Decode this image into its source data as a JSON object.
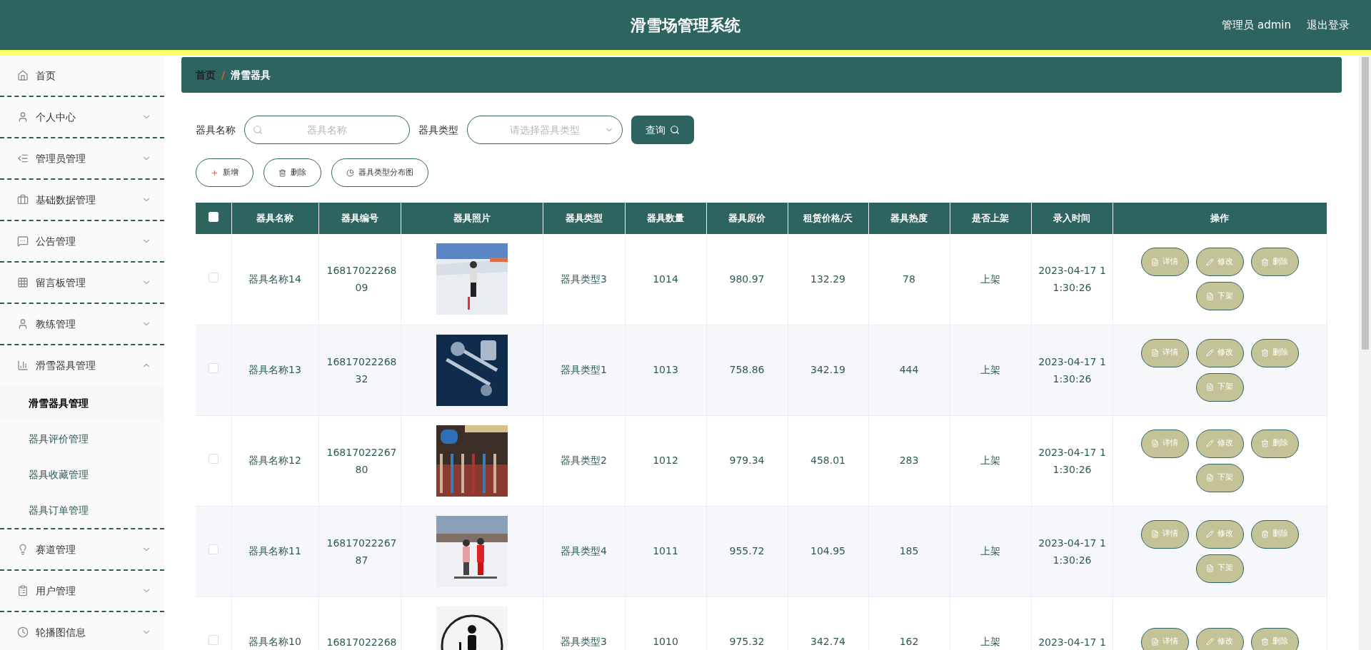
{
  "header": {
    "title": "滑雪场管理系统",
    "user": "管理员 admin",
    "logout": "退出登录"
  },
  "sidebar": {
    "items": [
      {
        "label": "首页"
      },
      {
        "label": "个人中心",
        "expanded": false
      },
      {
        "label": "管理员管理",
        "expanded": false
      },
      {
        "label": "基础数据管理",
        "expanded": false
      },
      {
        "label": "公告管理",
        "expanded": false
      },
      {
        "label": "留言板管理",
        "expanded": false
      },
      {
        "label": "教练管理",
        "expanded": false
      },
      {
        "label": "滑雪器具管理",
        "expanded": true,
        "children": [
          {
            "label": "滑雪器具管理",
            "selected": true
          },
          {
            "label": "器具评价管理",
            "selected": false
          },
          {
            "label": "器具收藏管理",
            "selected": false
          },
          {
            "label": "器具订单管理",
            "selected": false
          }
        ]
      },
      {
        "label": "赛道管理",
        "expanded": false
      },
      {
        "label": "用户管理",
        "expanded": false
      },
      {
        "label": "轮播图信息",
        "expanded": false
      }
    ]
  },
  "breadcrumb": [
    "首页",
    "/",
    "滑雪器具"
  ],
  "search": {
    "fields": [
      {
        "label": "器具名称",
        "kind": "text",
        "placeholder": "器具名称"
      },
      {
        "label": "器具类型",
        "kind": "select",
        "placeholder": "请选择器具类型"
      }
    ],
    "button": "查询"
  },
  "actions": [
    {
      "label": "新增",
      "kind": "add"
    },
    {
      "label": "删除",
      "kind": "delete"
    },
    {
      "label": "器具类型分布图",
      "kind": "chart"
    }
  ],
  "table": {
    "header_checked": false,
    "columns": [
      "器具名称",
      "器具编号",
      "器具照片",
      "器具类型",
      "器具数量",
      "器具原价",
      "租赁价格/天",
      "器具热度",
      "是否上架",
      "录入时间",
      "操作"
    ],
    "rows": [
      {
        "checked": false,
        "name": "器具名称14",
        "code": "1681702226809",
        "photo": {
          "kind": "picture"
        },
        "type": "器具类型3",
        "qty": "1014",
        "price": "980.97",
        "rent": "132.29",
        "heat": "78",
        "shelf": "上架",
        "time": "2023-04-17 11:30:26",
        "ops": [
          {
            "label": "详情",
            "kind": "detail"
          },
          {
            "label": "修改",
            "kind": "edit"
          },
          {
            "label": "删除",
            "kind": "delete"
          },
          {
            "label": "下架",
            "kind": "detail"
          }
        ]
      },
      {
        "checked": false,
        "name": "器具名称13",
        "code": "1681702226832",
        "photo": {
          "kind": "picture"
        },
        "type": "器具类型1",
        "qty": "1013",
        "price": "758.86",
        "rent": "342.19",
        "heat": "444",
        "shelf": "上架",
        "time": "2023-04-17 11:30:26",
        "ops": [
          {
            "label": "详情",
            "kind": "detail"
          },
          {
            "label": "修改",
            "kind": "edit"
          },
          {
            "label": "删除",
            "kind": "delete"
          },
          {
            "label": "下架",
            "kind": "detail"
          }
        ]
      },
      {
        "checked": false,
        "name": "器具名称12",
        "code": "1681702226780",
        "photo": {
          "kind": "picture"
        },
        "type": "器具类型2",
        "qty": "1012",
        "price": "979.34",
        "rent": "458.01",
        "heat": "283",
        "shelf": "上架",
        "time": "2023-04-17 11:30:26",
        "ops": [
          {
            "label": "详情",
            "kind": "detail"
          },
          {
            "label": "修改",
            "kind": "edit"
          },
          {
            "label": "删除",
            "kind": "delete"
          },
          {
            "label": "下架",
            "kind": "detail"
          }
        ]
      },
      {
        "checked": false,
        "name": "器具名称11",
        "code": "1681702226787",
        "photo": {
          "kind": "picture"
        },
        "type": "器具类型4",
        "qty": "1011",
        "price": "955.72",
        "rent": "104.95",
        "heat": "185",
        "shelf": "上架",
        "time": "2023-04-17 11:30:26",
        "ops": [
          {
            "label": "详情",
            "kind": "detail"
          },
          {
            "label": "修改",
            "kind": "edit"
          },
          {
            "label": "删除",
            "kind": "delete"
          },
          {
            "label": "下架",
            "kind": "detail"
          }
        ]
      },
      {
        "checked": false,
        "name": "器具名称10",
        "code": "16817022268",
        "photo": {
          "kind": "picture"
        },
        "type": "器具类型3",
        "qty": "1010",
        "price": "975.32",
        "rent": "342.74",
        "heat": "162",
        "shelf": "上架",
        "time": "2023-04-17 1",
        "ops": [
          {
            "label": "详情",
            "kind": "detail"
          },
          {
            "label": "修改",
            "kind": "edit"
          },
          {
            "label": "删除",
            "kind": "delete"
          }
        ]
      }
    ]
  }
}
